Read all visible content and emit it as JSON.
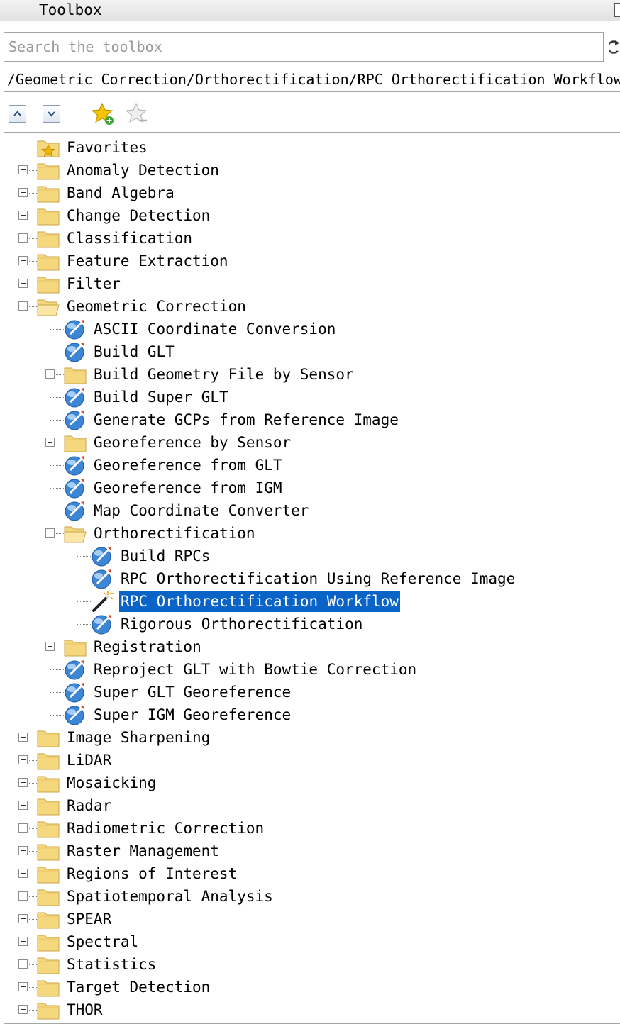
{
  "window": {
    "title": "Toolbox"
  },
  "search": {
    "placeholder": "Search the toolbox",
    "value": ""
  },
  "path": {
    "text": "/Geometric Correction/Orthorectification/RPC Orthorectification Workflow"
  },
  "toolbar": {
    "buttons": [
      {
        "icon": "collapse-up-icon"
      },
      {
        "icon": "expand-down-icon"
      },
      {
        "icon": "add-favorite-star-icon"
      },
      {
        "icon": "remove-favorite-star-icon"
      }
    ]
  },
  "tree": {
    "selected_label": "RPC Orthorectification Workflow",
    "selection_color": "#0a64c8",
    "nodes": [
      {
        "label": "Favorites",
        "depth": 0,
        "type": "favorites-folder",
        "expander": "none"
      },
      {
        "label": "Anomaly Detection",
        "depth": 0,
        "type": "folder",
        "expander": "plus"
      },
      {
        "label": "Band Algebra",
        "depth": 0,
        "type": "folder",
        "expander": "plus"
      },
      {
        "label": "Change Detection",
        "depth": 0,
        "type": "folder",
        "expander": "plus"
      },
      {
        "label": "Classification",
        "depth": 0,
        "type": "folder",
        "expander": "plus"
      },
      {
        "label": "Feature Extraction",
        "depth": 0,
        "type": "folder",
        "expander": "plus"
      },
      {
        "label": "Filter",
        "depth": 0,
        "type": "folder",
        "expander": "plus"
      },
      {
        "label": "Geometric Correction",
        "depth": 0,
        "type": "open-folder",
        "expander": "minus"
      },
      {
        "label": "ASCII Coordinate Conversion",
        "depth": 1,
        "type": "tool",
        "expander": "none"
      },
      {
        "label": "Build GLT",
        "depth": 1,
        "type": "tool",
        "expander": "none"
      },
      {
        "label": "Build Geometry File by Sensor",
        "depth": 1,
        "type": "folder",
        "expander": "plus"
      },
      {
        "label": "Build Super GLT",
        "depth": 1,
        "type": "tool",
        "expander": "none"
      },
      {
        "label": "Generate GCPs from Reference Image",
        "depth": 1,
        "type": "tool",
        "expander": "none"
      },
      {
        "label": "Georeference by Sensor",
        "depth": 1,
        "type": "folder",
        "expander": "plus"
      },
      {
        "label": "Georeference from GLT",
        "depth": 1,
        "type": "tool",
        "expander": "none"
      },
      {
        "label": "Georeference from IGM",
        "depth": 1,
        "type": "tool",
        "expander": "none"
      },
      {
        "label": "Map Coordinate Converter",
        "depth": 1,
        "type": "tool",
        "expander": "none"
      },
      {
        "label": "Orthorectification",
        "depth": 1,
        "type": "open-folder",
        "expander": "minus"
      },
      {
        "label": "Build RPCs",
        "depth": 2,
        "type": "tool",
        "expander": "none"
      },
      {
        "label": "RPC Orthorectification Using Reference Image",
        "depth": 2,
        "type": "tool",
        "expander": "none"
      },
      {
        "label": "RPC Orthorectification Workflow",
        "depth": 2,
        "type": "wand",
        "expander": "none",
        "selected": true
      },
      {
        "label": "Rigorous Orthorectification",
        "depth": 2,
        "type": "tool",
        "expander": "none"
      },
      {
        "label": "Registration",
        "depth": 1,
        "type": "folder",
        "expander": "plus"
      },
      {
        "label": "Reproject GLT with Bowtie Correction",
        "depth": 1,
        "type": "tool",
        "expander": "none"
      },
      {
        "label": "Super GLT Georeference",
        "depth": 1,
        "type": "tool",
        "expander": "none"
      },
      {
        "label": "Super IGM Georeference",
        "depth": 1,
        "type": "tool",
        "expander": "none"
      },
      {
        "label": "Image Sharpening",
        "depth": 0,
        "type": "folder",
        "expander": "plus"
      },
      {
        "label": "LiDAR",
        "depth": 0,
        "type": "folder",
        "expander": "plus"
      },
      {
        "label": "Mosaicking",
        "depth": 0,
        "type": "folder",
        "expander": "plus"
      },
      {
        "label": "Radar",
        "depth": 0,
        "type": "folder",
        "expander": "plus"
      },
      {
        "label": "Radiometric Correction",
        "depth": 0,
        "type": "folder",
        "expander": "plus"
      },
      {
        "label": "Raster Management",
        "depth": 0,
        "type": "folder",
        "expander": "plus"
      },
      {
        "label": "Regions of Interest",
        "depth": 0,
        "type": "folder",
        "expander": "plus"
      },
      {
        "label": "Spatiotemporal Analysis",
        "depth": 0,
        "type": "folder",
        "expander": "plus"
      },
      {
        "label": "SPEAR",
        "depth": 0,
        "type": "folder",
        "expander": "plus"
      },
      {
        "label": "Spectral",
        "depth": 0,
        "type": "folder",
        "expander": "plus"
      },
      {
        "label": "Statistics",
        "depth": 0,
        "type": "folder",
        "expander": "plus"
      },
      {
        "label": "Target Detection",
        "depth": 0,
        "type": "folder",
        "expander": "plus"
      },
      {
        "label": "THOR",
        "depth": 0,
        "type": "folder",
        "expander": "plus"
      }
    ]
  }
}
